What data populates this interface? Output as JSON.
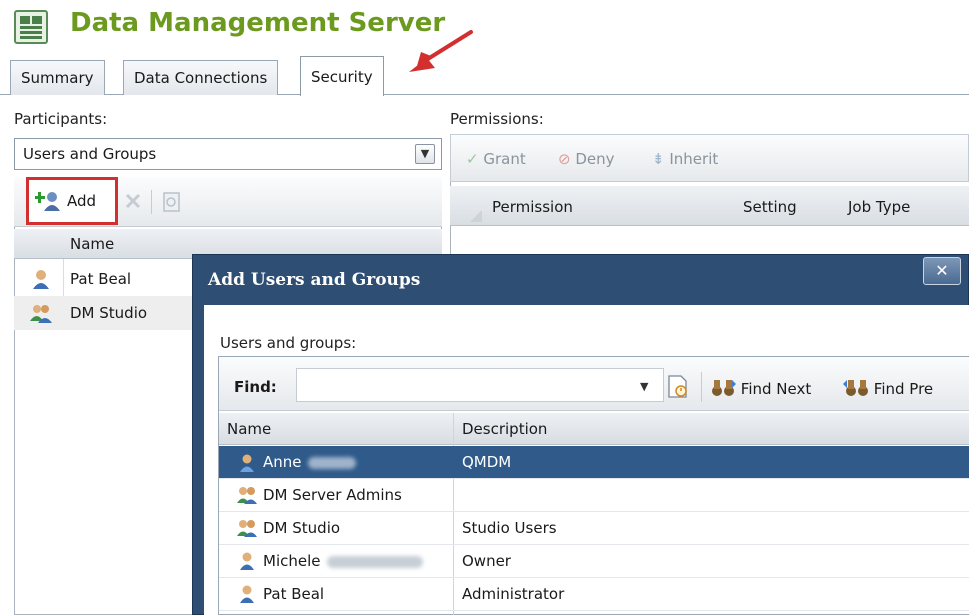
{
  "header": {
    "title": "Data Management Server"
  },
  "tabs": [
    {
      "label": "Summary"
    },
    {
      "label": "Data Connections"
    },
    {
      "label": "Security"
    }
  ],
  "participants": {
    "label": "Participants:",
    "select_value": "Users and Groups",
    "add_label": "Add",
    "column_name": "Name",
    "rows": [
      {
        "name": "Pat Beal",
        "type": "user"
      },
      {
        "name": "DM Studio",
        "type": "group"
      }
    ]
  },
  "permissions": {
    "label": "Permissions:",
    "grant_label": "Grant",
    "deny_label": "Deny",
    "inherit_label": "Inherit",
    "columns": [
      "Permission",
      "Setting",
      "Job Type"
    ]
  },
  "dialog": {
    "title": "Add Users and Groups",
    "close_glyph": "✕",
    "section_label": "Users and groups:",
    "find_label": "Find:",
    "find_value": "",
    "find_next_label": "Find Next",
    "find_prev_label": "Find Pre",
    "columns": [
      "Name",
      "Description"
    ],
    "rows": [
      {
        "name": "Anne",
        "description": "QMDM",
        "type": "user",
        "selected": true
      },
      {
        "name": "DM Server Admins",
        "description": "",
        "type": "group",
        "selected": false
      },
      {
        "name": "DM Studio",
        "description": "Studio Users",
        "type": "group",
        "selected": false
      },
      {
        "name": "Michele",
        "description": "Owner",
        "type": "user",
        "selected": false
      },
      {
        "name": "Pat Beal",
        "description": "Administrator",
        "type": "user",
        "selected": false
      }
    ]
  },
  "colors": {
    "title_green": "#6b9a1f",
    "dialog_blue": "#2e4e74",
    "selection_blue": "#2f5a8a",
    "highlight_red": "#d32f2f"
  }
}
